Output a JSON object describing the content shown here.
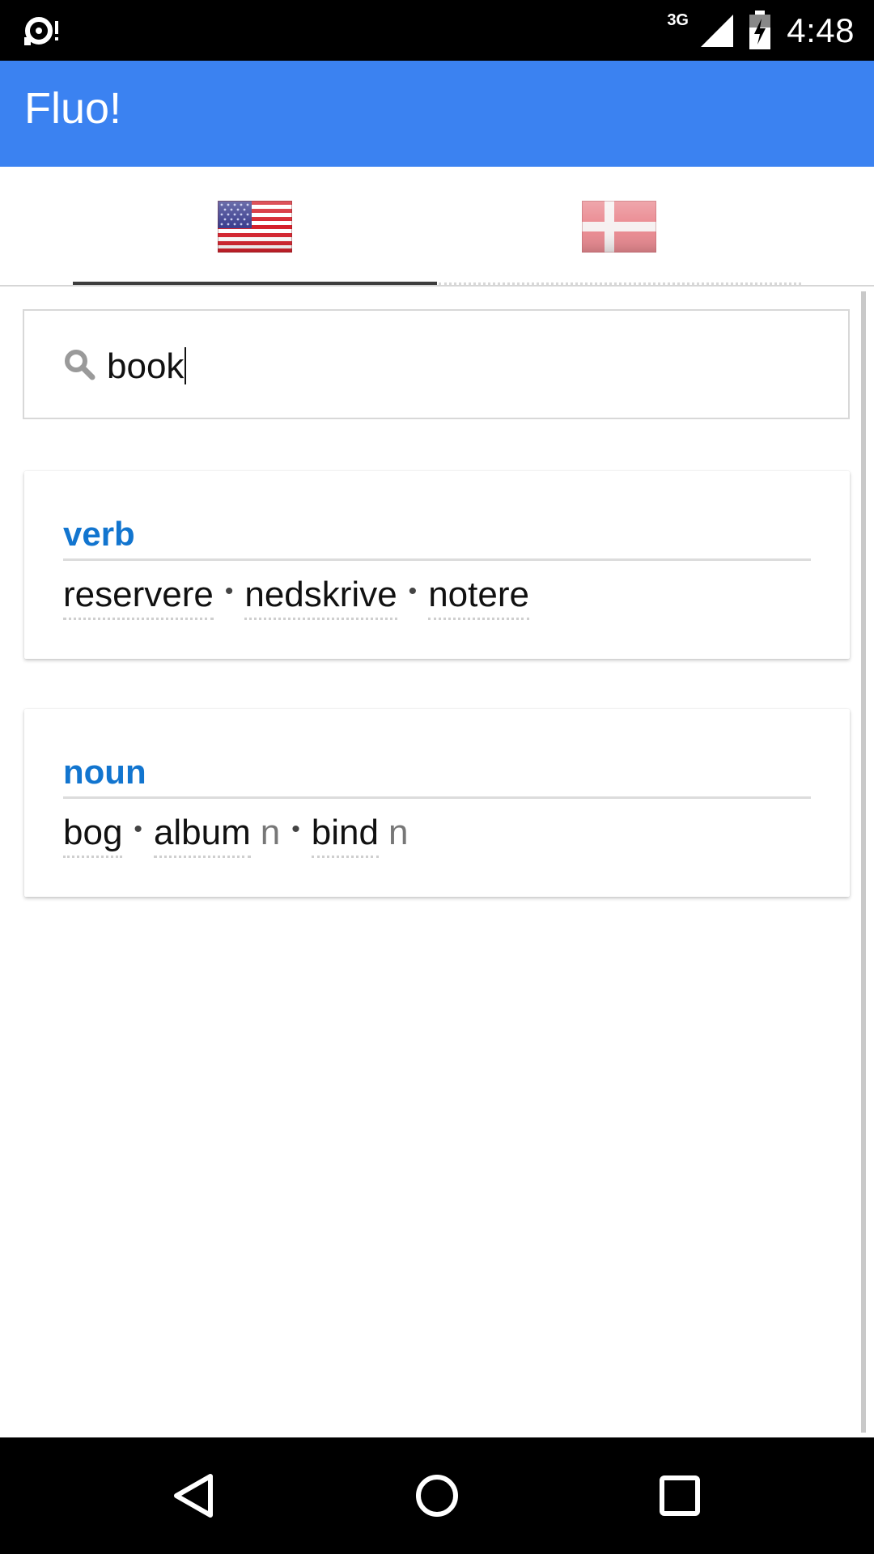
{
  "status_bar": {
    "time": "4:48",
    "network": "3G"
  },
  "app": {
    "title": "Fluo!"
  },
  "tabs": [
    {
      "name": "English (US)",
      "icon": "us-flag-icon",
      "selected": true
    },
    {
      "name": "Danish",
      "icon": "dk-flag-icon",
      "selected": false
    }
  ],
  "search": {
    "value": "book"
  },
  "results": [
    {
      "pos": "verb",
      "terms": [
        {
          "word": "reservere",
          "gender": ""
        },
        {
          "word": "nedskrive",
          "gender": ""
        },
        {
          "word": "notere",
          "gender": ""
        }
      ]
    },
    {
      "pos": "noun",
      "terms": [
        {
          "word": "bog",
          "gender": ""
        },
        {
          "word": "album",
          "gender": "n"
        },
        {
          "word": "bind",
          "gender": "n"
        }
      ]
    }
  ],
  "separator": "•",
  "colors": {
    "app_bar": "#3b82f1",
    "pos_label": "#1275cf",
    "status_bar": "#000000"
  }
}
